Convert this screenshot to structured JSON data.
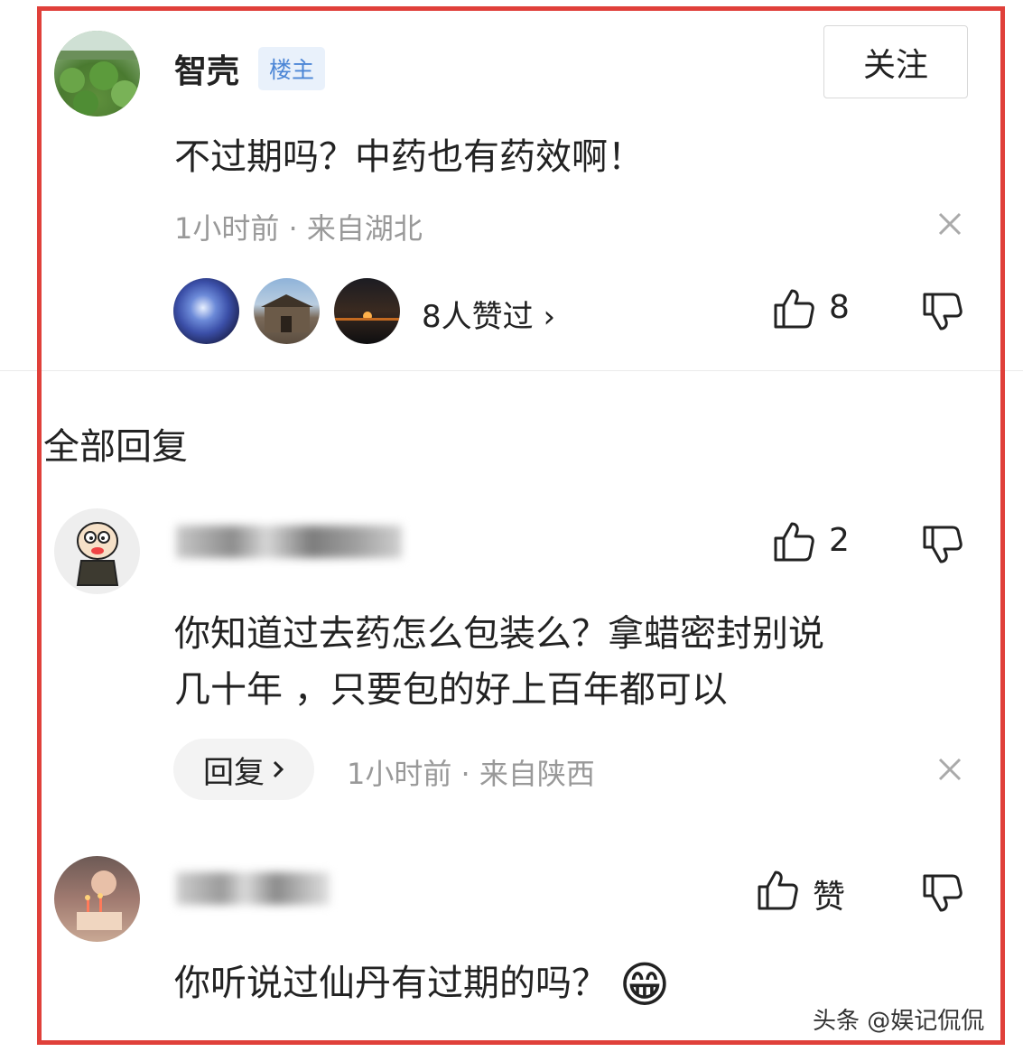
{
  "op": {
    "name": "智壳",
    "badge": "楼主",
    "follow_label": "关注",
    "text": "不过期吗？中药也有药效啊！",
    "time": "1小时前",
    "location": "来自湖北",
    "likers_text": "8人赞过 ›",
    "like_count": "8"
  },
  "section_title": "全部回复",
  "replies": [
    {
      "text_line1": "你知道过去药怎么包装么？拿蜡密封别说",
      "text_line2": "几十年 ，只要包的好上百年都可以",
      "like_count": "2",
      "reply_label": "回复",
      "time": "1小时前",
      "location": "来自陕西"
    },
    {
      "text": "你听说过仙丹有过期的吗？",
      "like_label": "赞",
      "emoji": "😁"
    }
  ],
  "watermark": "头条 @娱记侃侃"
}
